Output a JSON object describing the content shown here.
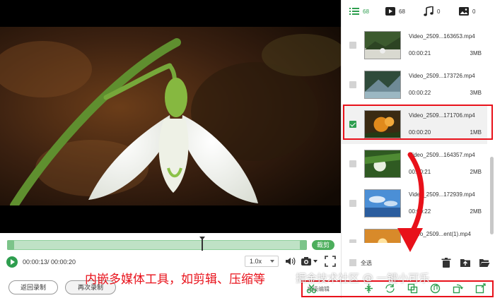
{
  "tabs": [
    {
      "icon": "list-icon",
      "count": "68"
    },
    {
      "icon": "video-icon",
      "count": "68"
    },
    {
      "icon": "music-icon",
      "count": "0"
    },
    {
      "icon": "image-icon",
      "count": "0"
    }
  ],
  "files": [
    {
      "name": "Video_2509...163653.mp4",
      "duration": "00:00:21",
      "size": "3MB",
      "selected": false
    },
    {
      "name": "Video_2509...173726.mp4",
      "duration": "00:00:22",
      "size": "3MB",
      "selected": false
    },
    {
      "name": "Video_2509...171706.mp4",
      "duration": "00:00:20",
      "size": "1MB",
      "selected": true
    },
    {
      "name": "Video_2509...164357.mp4",
      "duration": "00:00:21",
      "size": "2MB",
      "selected": false
    },
    {
      "name": "Video_2509...172939.mp4",
      "duration": "00:00:22",
      "size": "2MB",
      "selected": false
    },
    {
      "name": "Video_2509...ent(1).mp4",
      "duration": "",
      "size": "",
      "selected": false
    }
  ],
  "player": {
    "time": "00:00:13/ 00:00:20",
    "speed": "1.0x",
    "cut_label": "裁剪",
    "progress": 0.65
  },
  "buttons": {
    "back": "返回录制",
    "rerecord": "再次录制"
  },
  "select_all": "全选",
  "tools": {
    "advanced_label": "高级编辑"
  },
  "caption": "内嵌多媒体工具，如剪辑、压缩等",
  "watermark": "掘金技术社区 @ 一键小可乐",
  "colors": {
    "accent": "#2e9e4f",
    "annotation": "#e8111a"
  }
}
